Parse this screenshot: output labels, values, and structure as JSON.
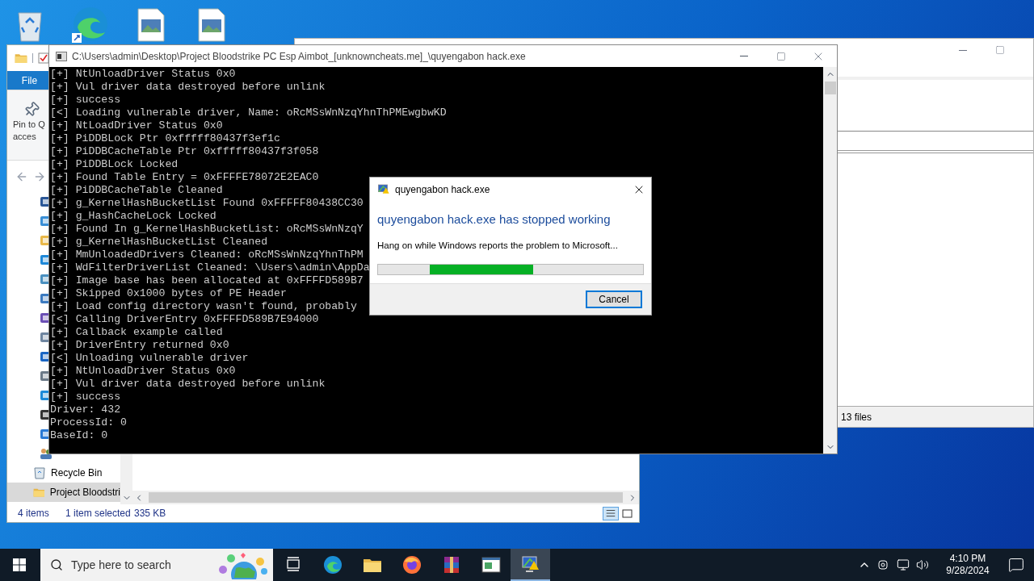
{
  "back_window": {
    "status": "13 files"
  },
  "explorer": {
    "ribbon_tab": "File",
    "pin_label_lines": [
      "Pin to Q",
      "acces"
    ],
    "nav_items": [
      {
        "label": "Recycle Bin",
        "selected": false
      },
      {
        "label": "Project Bloodstri",
        "selected": true
      }
    ],
    "status": {
      "count": "4 items",
      "selection": "1 item selected",
      "size": "335 KB"
    }
  },
  "console": {
    "title": "C:\\Users\\admin\\Desktop\\Project Bloodstrike PC Esp Aimbot_[unknowncheats.me]_\\quyengabon hack.exe",
    "lines": [
      "[+] NtUnloadDriver Status 0x0",
      "[+] Vul driver data destroyed before unlink",
      "[+] success",
      "[<] Loading vulnerable driver, Name: oRcMSsWnNzqYhnThPMEwgbwKD",
      "[+] NtLoadDriver Status 0x0",
      "[+] PiDDBLock Ptr 0xfffff80437f3ef1c",
      "[+] PiDDBCacheTable Ptr 0xfffff80437f3f058",
      "[+] PiDDBLock Locked",
      "[+] Found Table Entry = 0xFFFFE78072E2EAC0",
      "[+] PiDDBCacheTable Cleaned",
      "[+] g_KernelHashBucketList Found 0xFFFFF80438CC30",
      "[+] g_HashCacheLock Locked",
      "[+] Found In g_KernelHashBucketList: oRcMSsWnNzqY",
      "[+] g_KernelHashBucketList Cleaned",
      "[+] MmUnloadedDrivers Cleaned: oRcMSsWnNzqYhnThPM",
      "[+] WdFilterDriverList Cleaned: \\Users\\admin\\AppDa",
      "[+] Image base has been allocated at 0xFFFFD589B7",
      "[+] Skipped 0x1000 bytes of PE Header",
      "[+] Load config directory wasn't found, probably",
      "[<] Calling DriverEntry 0xFFFFD589B7E94000",
      "[+] Callback example called",
      "[+] DriverEntry returned 0x0",
      "[<] Unloading vulnerable driver",
      "[+] NtUnloadDriver Status 0x0",
      "[+] Vul driver data destroyed before unlink",
      "[+] success",
      "Driver: 432",
      "ProcessId: 0",
      "BaseId: 0"
    ]
  },
  "dialog": {
    "title": "quyengabon hack.exe",
    "heading": "quyengabon hack.exe has stopped working",
    "message": "Hang on while Windows reports the problem to Microsoft...",
    "progress": {
      "level": 0.39
    },
    "button": "Cancel"
  },
  "taskbar": {
    "search_placeholder": "Type here to search",
    "apps": [
      {
        "kind": "taskview",
        "selected": false
      },
      {
        "kind": "edge",
        "selected": false
      },
      {
        "kind": "folder",
        "selected": false
      },
      {
        "kind": "firefox",
        "selected": false
      },
      {
        "kind": "archive",
        "selected": false
      },
      {
        "kind": "window",
        "selected": false
      },
      {
        "kind": "report",
        "selected": true
      }
    ],
    "time": "4:10 PM",
    "date": "9/28/2024"
  }
}
